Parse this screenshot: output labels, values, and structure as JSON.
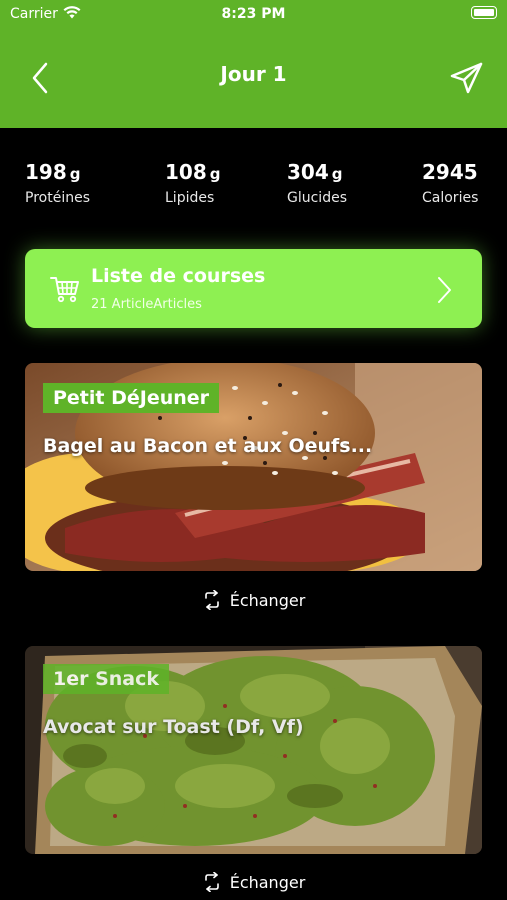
{
  "status_bar": {
    "carrier": "Carrier",
    "time": "8:23 PM"
  },
  "header": {
    "title": "Jour 1",
    "back_icon": "chevron-left-icon",
    "send_icon": "paper-plane-icon"
  },
  "colors": {
    "header_bg": "#5fb328",
    "shopping_card_bg": "#8ef052",
    "tag_bg": "#5fb328",
    "background": "#000000"
  },
  "macros": [
    {
      "value": "198",
      "unit": "g",
      "label": "Protéines"
    },
    {
      "value": "108",
      "unit": "g",
      "label": "Lipides"
    },
    {
      "value": "304",
      "unit": "g",
      "label": "Glucides"
    },
    {
      "value": "2945",
      "unit": "",
      "label": "Calories"
    }
  ],
  "shopping_list": {
    "title": "Liste de courses",
    "subtitle": "21 ArticleArticles",
    "icon": "cart-icon"
  },
  "meals": [
    {
      "tag": "Petit DéJeuner",
      "name": "Bagel au Bacon et aux Oeufs...",
      "swap_label": "Échanger"
    },
    {
      "tag": "1er Snack",
      "name": "Avocat sur Toast (Df, Vf)",
      "swap_label": "Échanger"
    }
  ]
}
